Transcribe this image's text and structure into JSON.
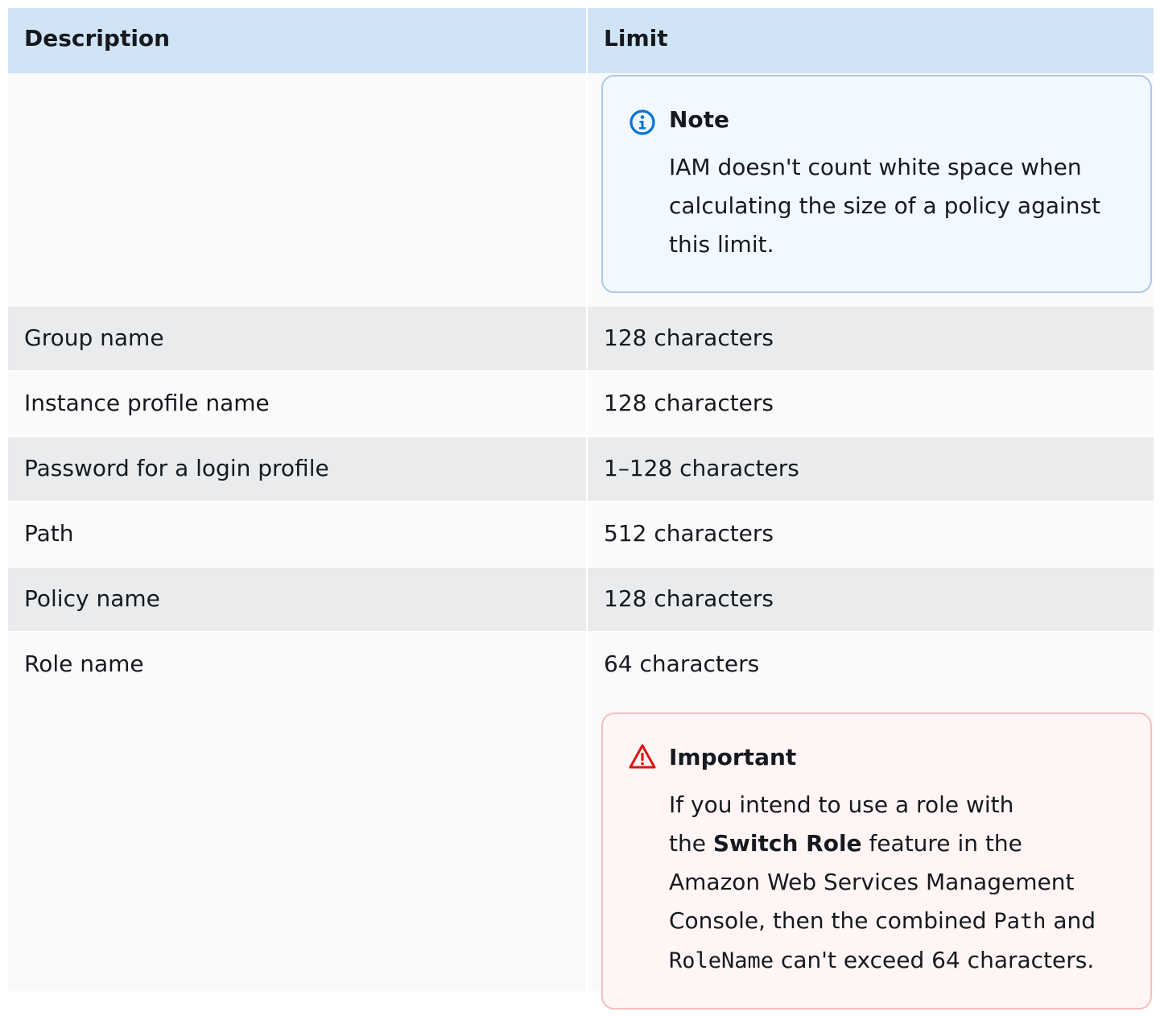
{
  "table": {
    "headers": {
      "description": "Description",
      "limit": "Limit"
    },
    "rows": [
      {
        "description": "Group name",
        "limit": "128 characters"
      },
      {
        "description": "Instance profile name",
        "limit": "128 characters"
      },
      {
        "description": "Password for a login profile",
        "limit": "1–128 characters"
      },
      {
        "description": "Path",
        "limit": "512 characters"
      },
      {
        "description": "Policy name",
        "limit": "128 characters"
      },
      {
        "description": "Role name",
        "limit": "64 characters"
      }
    ]
  },
  "note": {
    "icon": "info-icon",
    "title": "Note",
    "text": "IAM doesn't count white space when calculating the size of a policy against this limit."
  },
  "important": {
    "icon": "warning-icon",
    "title": "Important",
    "line1": "If you intend to use a role with",
    "line2_pre": "the ",
    "line2_bold": "Switch Role",
    "line2_post": " feature in the",
    "line3": "Amazon Web Services Management",
    "line4_pre": "Console, then the combined ",
    "line4_code": "Path",
    "line4_post": " and",
    "line5_code": "RoleName",
    "line5_post": " can't exceed 64 characters."
  },
  "colors": {
    "header_bg": "#d1e4f5",
    "row_alt_bg": "#e9ebed",
    "note_bg": "#f1f8ff",
    "note_accent": "#0972d3",
    "important_bg": "#fff5f5",
    "important_accent": "#d91515"
  }
}
